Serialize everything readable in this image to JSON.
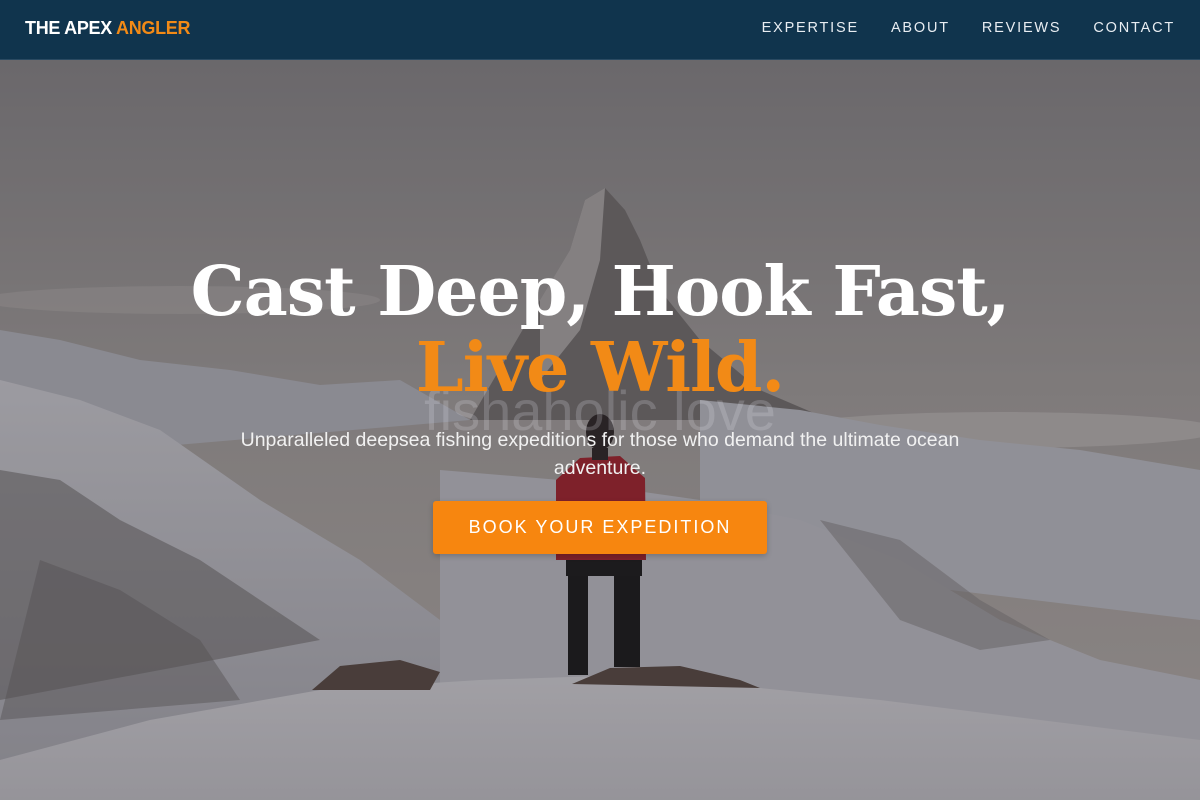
{
  "brand": {
    "name_primary": "THE APEX",
    "name_accent": "ANGLER"
  },
  "nav": {
    "items": [
      {
        "label": "EXPERTISE"
      },
      {
        "label": "ABOUT"
      },
      {
        "label": "REVIEWS"
      },
      {
        "label": "CONTACT"
      }
    ]
  },
  "hero": {
    "headline_line1": "Cast Deep, Hook Fast,",
    "headline_line2": "Live Wild.",
    "watermark": "fishaholic love",
    "subtitle": "Unparalleled deepsea fishing expeditions for those who demand the ultimate ocean adventure.",
    "cta_label": "BOOK YOUR EXPEDITION",
    "background_image": "snowy-mountain-peak-with-hiker"
  },
  "colors": {
    "navbar_bg": "#10344d",
    "accent": "#f28a16",
    "cta_bg": "#f7860f",
    "text_light": "#ffffff"
  }
}
